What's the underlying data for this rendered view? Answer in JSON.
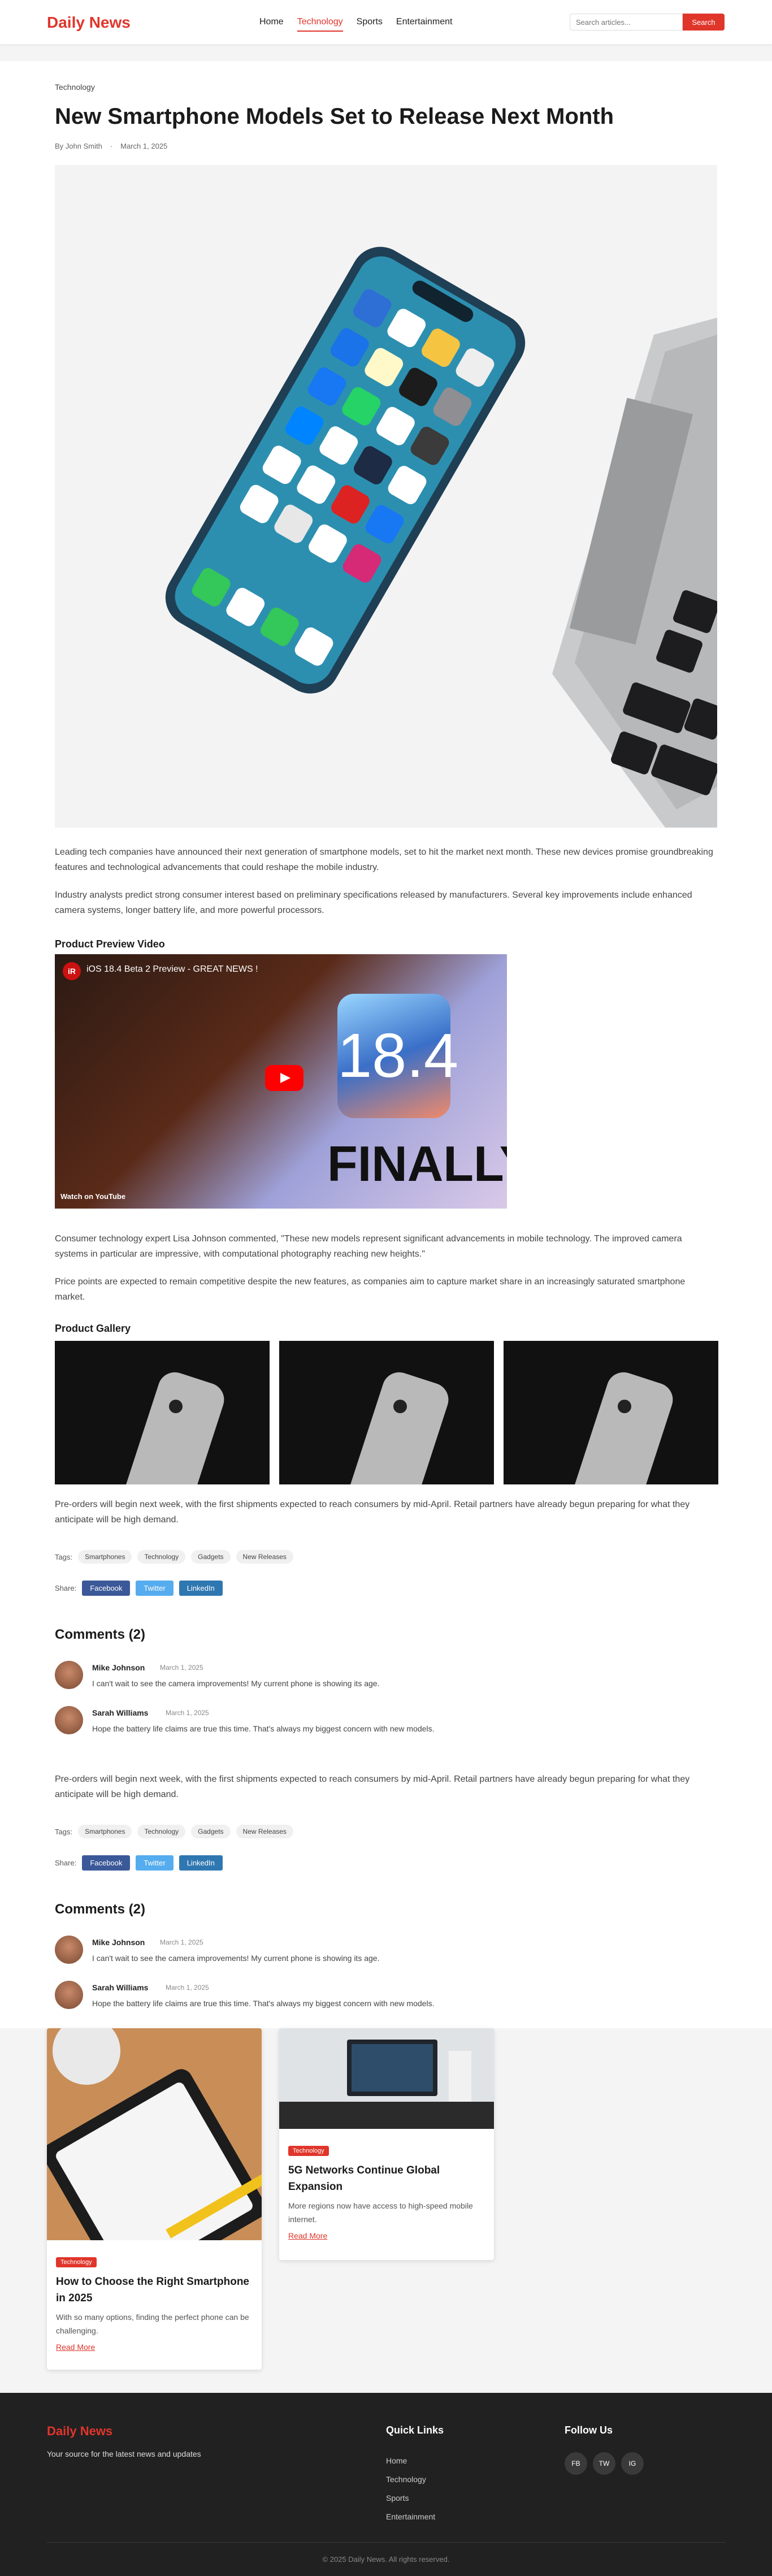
{
  "header": {
    "brand": "Daily News",
    "nav": [
      "Home",
      "Technology",
      "Sports",
      "Entertainment"
    ],
    "active_nav": "Technology",
    "search_placeholder": "Search articles...",
    "search_button": "Search"
  },
  "article": {
    "category": "Technology",
    "title": "New Smartphone Models Set to Release Next Month",
    "author": "By John Smith",
    "date": "March 1, 2025",
    "paragraphs": [
      "Leading tech companies have announced their next generation of smartphone models, set to hit the market next month. These new devices promise groundbreaking features and technological advancements that could reshape the mobile industry.",
      "Industry analysts predict strong consumer interest based on preliminary specifications released by manufacturers. Several key improvements include enhanced camera systems, longer battery life, and more powerful processors.",
      "Consumer technology expert Lisa Johnson commented, \"These new models represent significant advancements in mobile technology. The improved camera systems in particular are impressive, with computational photography reaching new heights.\"",
      "Price points are expected to remain competitive despite the new features, as companies aim to capture market share in an increasingly saturated smartphone market.",
      "Pre-orders will begin next week, with the first shipments expected to reach consumers by mid-April. Retail partners have already begun preparing for what they anticipate will be high demand."
    ],
    "video_heading": "Product Preview Video",
    "video": {
      "title": "iOS 18.4 Beta 2 Preview - GREAT NEWS !",
      "badge": "18.4",
      "overlay_text": "FINALLY",
      "watch_on": "Watch on  YouTube"
    },
    "gallery_heading": "Product Gallery",
    "tags_label": "Tags:",
    "tags": [
      "Smartphones",
      "Technology",
      "Gadgets",
      "New Releases"
    ],
    "share_label": "Share:",
    "share_buttons": [
      "Facebook",
      "Twitter",
      "LinkedIn"
    ],
    "comments_heading": "Comments (2)",
    "comments": [
      {
        "name": "Mike Johnson",
        "date": "March 1, 2025",
        "text": "I can't wait to see the camera improvements! My current phone is showing its age."
      },
      {
        "name": "Sarah Williams",
        "date": "March 1, 2025",
        "text": "Hope the battery life claims are true this time. That's always my biggest concern with new models."
      }
    ]
  },
  "related": [
    {
      "badge": "Technology",
      "title": "How to Choose the Right Smartphone in 2025",
      "desc": "With so many options, finding the perfect phone can be challenging.",
      "more": "Read More"
    },
    {
      "badge": "Technology",
      "title": "5G Networks Continue Global Expansion",
      "desc": "More regions now have access to high-speed mobile internet.",
      "more": "Read More"
    }
  ],
  "footer": {
    "brand": "Daily News",
    "tagline": "Your source for the latest news and updates",
    "links_heading": "Quick Links",
    "links": [
      "Home",
      "Technology",
      "Sports",
      "Entertainment"
    ],
    "social_heading": "Follow Us",
    "social": [
      "FB",
      "TW",
      "IG"
    ],
    "copyright": "© 2025 Daily News. All rights reserved."
  },
  "colors": {
    "accent": "#e0352b",
    "facebook": "#3b5998",
    "twitter": "#55acee",
    "linkedin": "#2f77b1",
    "footer_bg": "#212121"
  }
}
